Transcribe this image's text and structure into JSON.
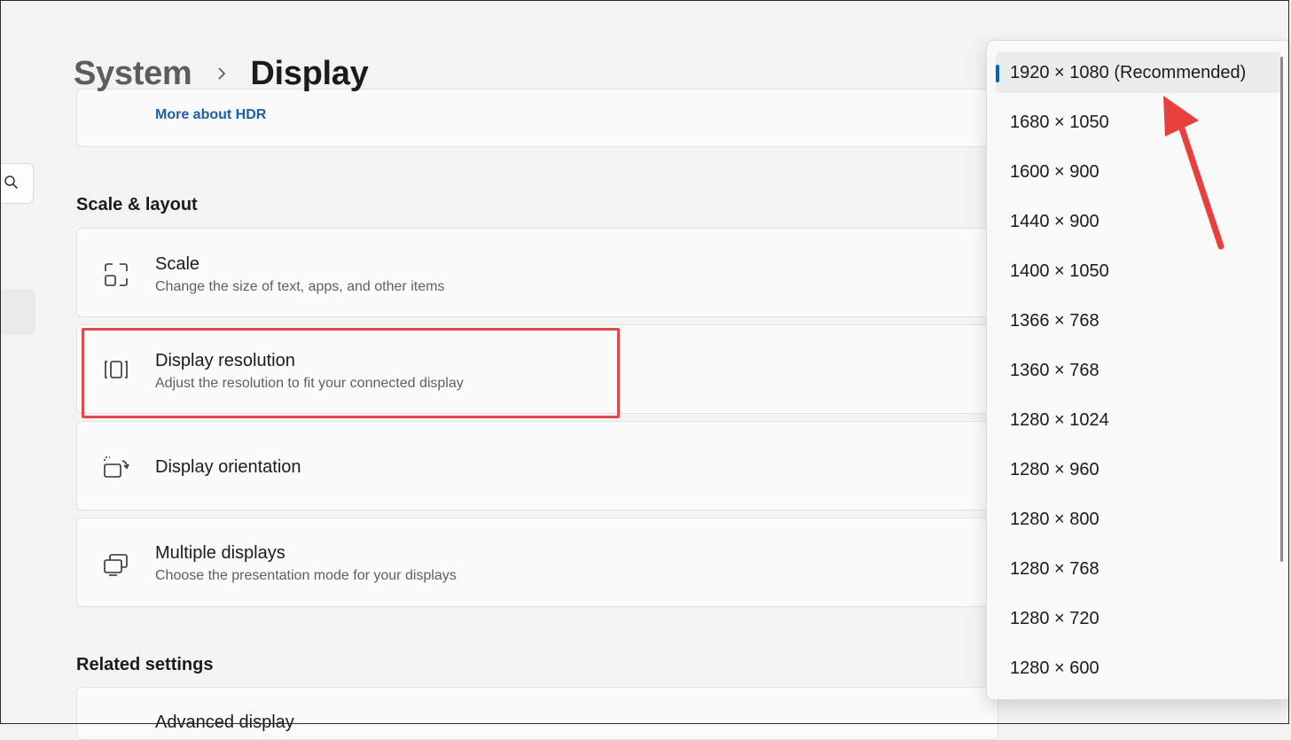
{
  "breadcrumb": {
    "parent": "System",
    "current": "Display"
  },
  "hdr": {
    "link": "More about HDR"
  },
  "sections": {
    "scale_layout": "Scale & layout",
    "related": "Related settings"
  },
  "cards": {
    "scale": {
      "title": "Scale",
      "desc": "Change the size of text, apps, and other items"
    },
    "resolution": {
      "title": "Display resolution",
      "desc": "Adjust the resolution to fit your connected display"
    },
    "orientation": {
      "title": "Display orientation"
    },
    "multiple": {
      "title": "Multiple displays",
      "desc": "Choose the presentation mode for your displays"
    },
    "advanced": {
      "title": "Advanced display"
    }
  },
  "resolution_options": [
    "1920 × 1080 (Recommended)",
    "1680 × 1050",
    "1600 × 900",
    "1440 × 900",
    "1400 × 1050",
    "1366 × 768",
    "1360 × 768",
    "1280 × 1024",
    "1280 × 960",
    "1280 × 800",
    "1280 × 768",
    "1280 × 720",
    "1280 × 600"
  ],
  "selected_option": "1920 × 1080 (Recommended)",
  "colors": {
    "accent": "#0067c0",
    "link": "#1a5fa8",
    "annotation": "#e14a4a"
  }
}
